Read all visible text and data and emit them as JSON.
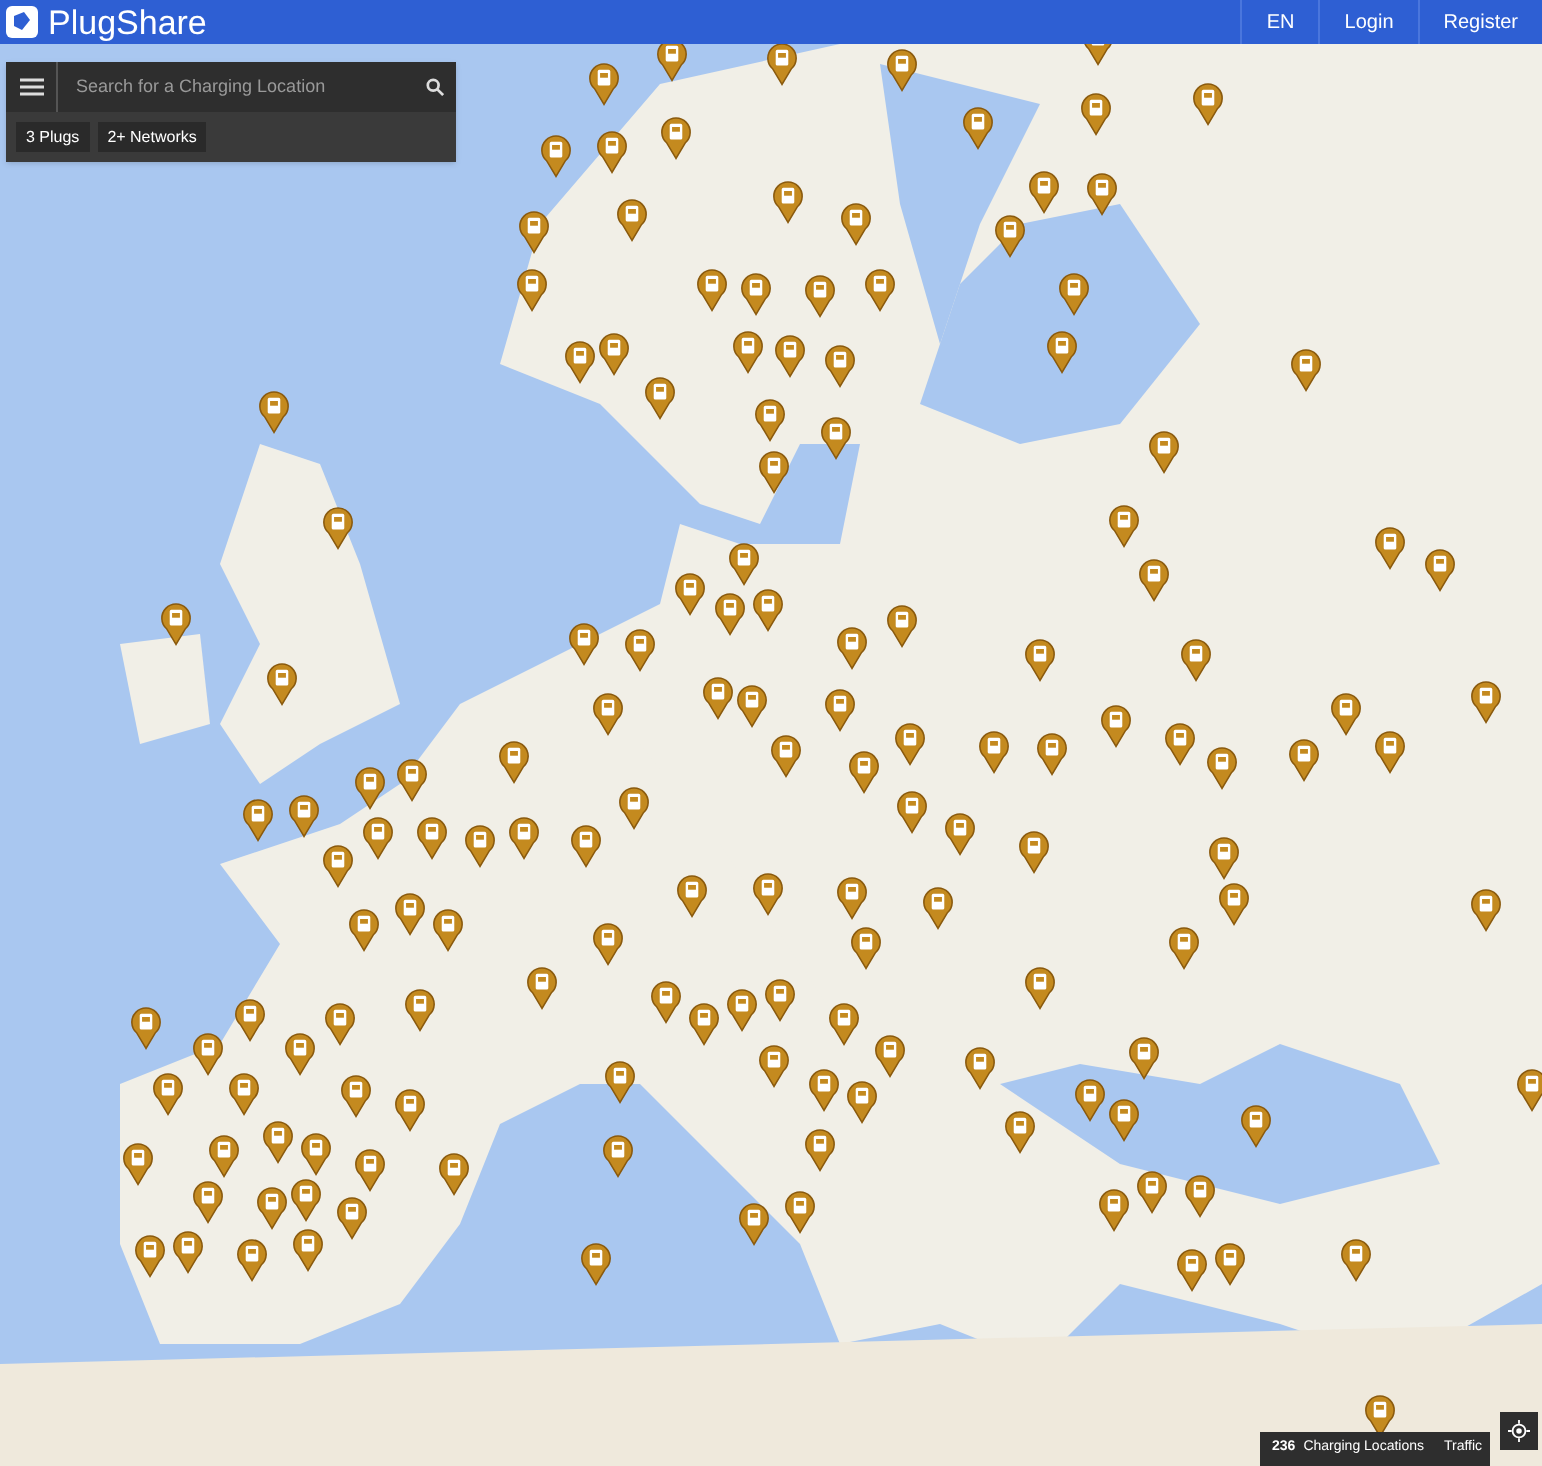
{
  "header": {
    "logo_text": "PlugShare",
    "nav": [
      {
        "label": "EN"
      },
      {
        "label": "Login"
      },
      {
        "label": "Register"
      }
    ]
  },
  "search": {
    "placeholder": "Search for a Charging Location"
  },
  "filters": [
    {
      "label": "3 Plugs"
    },
    {
      "label": "2+ Networks"
    }
  ],
  "footer": {
    "count": "236",
    "count_label": "Charging Locations",
    "traffic_button": "Traffic"
  }
}
